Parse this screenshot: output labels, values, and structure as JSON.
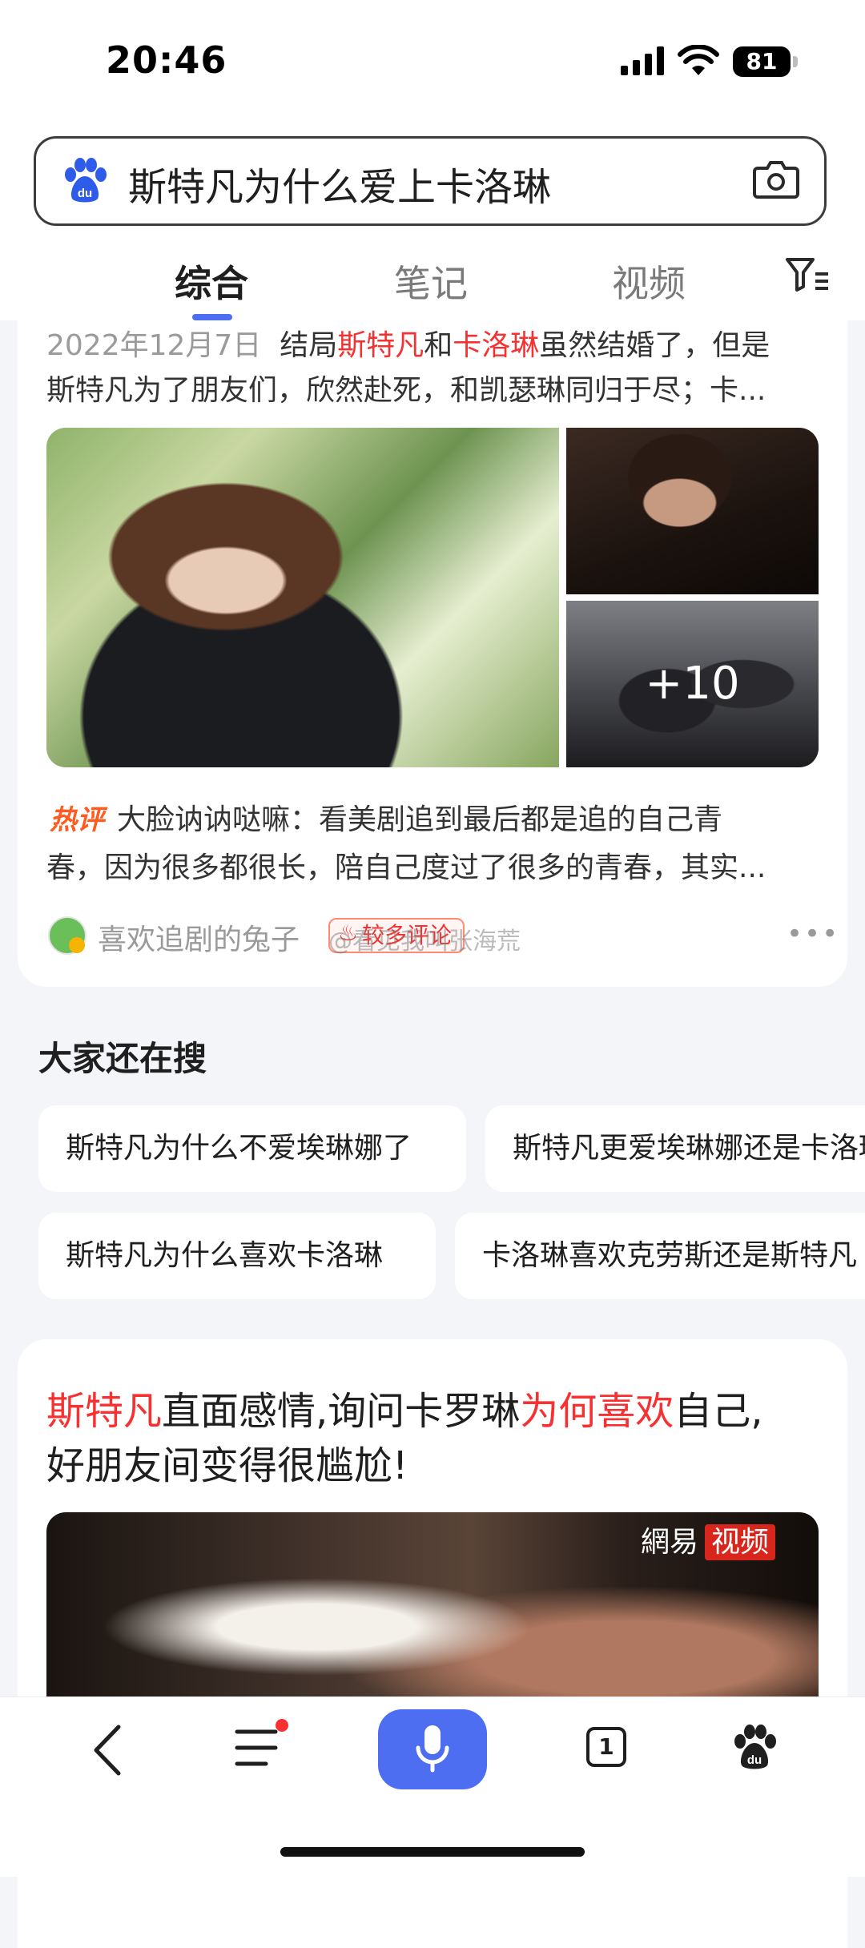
{
  "status": {
    "time": "20:46",
    "battery": "81"
  },
  "search": {
    "query": "斯特凡为什么爱上卡洛琳"
  },
  "tabs": [
    "综合",
    "笔记",
    "视频"
  ],
  "result1": {
    "date": "2022年12月7日",
    "snippet_parts": [
      "结局",
      "斯特凡",
      "和",
      "卡洛琳",
      "虽然结婚了，但是"
    ],
    "snippet_line2": "斯特凡为了朋友们，欣然赴死，和凯瑟琳同归于尽；卡...",
    "more_images": "+10",
    "hot_label": "热评",
    "hot_line1": "大脸讷讷哒嘛：看美剧追到最后都是追的自己青",
    "hot_line2": "春，因为很多都很长，陪自己度过了很多的青春，其实...",
    "author": "喜欢追剧的兔子",
    "tag": "较多评论",
    "watermark": "@看见我叫张海荒"
  },
  "related": {
    "title": "大家还在搜",
    "items": [
      "斯特凡为什么不爱埃琳娜了",
      "斯特凡更爱埃琳娜还是卡洛琳",
      "斯特凡为什么喜欢卡洛琳",
      "卡洛琳喜欢克劳斯还是斯特凡"
    ]
  },
  "result2": {
    "title_parts": [
      "斯特凡",
      "直面感情,询问卡罗琳",
      "为何喜欢",
      "自己,"
    ],
    "title_line2": "好朋友间变得很尴尬!",
    "video_brand": [
      "網易",
      "视频"
    ]
  },
  "bottom": {
    "tabs_count": "1"
  },
  "colors": {
    "accent": "#4e6ef2",
    "highlight": "#f73131",
    "background": "#f4f5f9"
  }
}
